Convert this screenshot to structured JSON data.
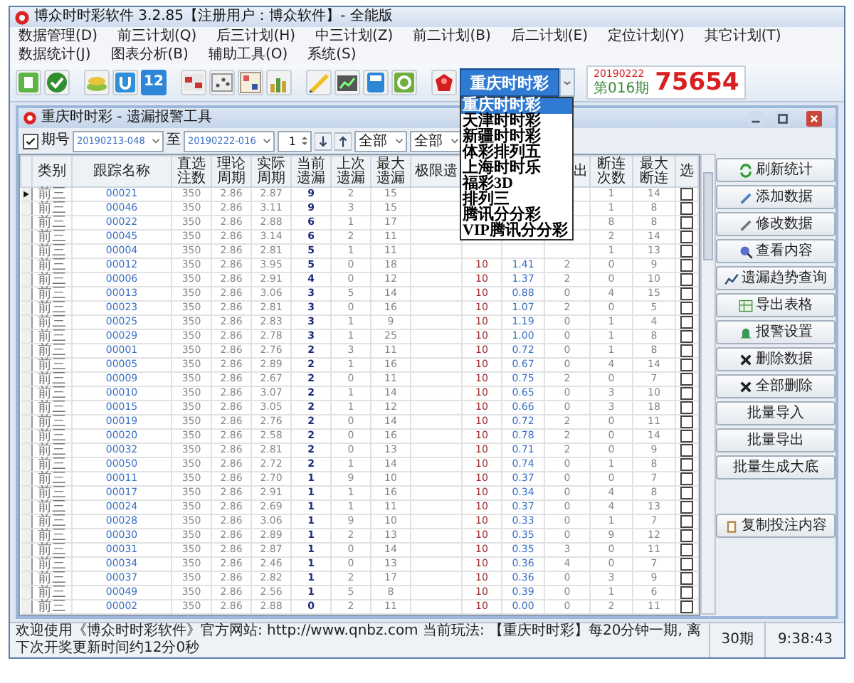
{
  "window": {
    "title": "博众时时彩软件 3.2.85【注册用户：博众软件】- 全能版"
  },
  "menu": [
    "数据管理(D)",
    "前三计划(Q)",
    "后三计划(H)",
    "中三计划(Z)",
    "前二计划(B)",
    "后二计划(E)",
    "定位计划(Y)",
    "其它计划(T)",
    "数据统计(J)",
    "图表分析(B)",
    "辅助工具(O)",
    "系统(S)"
  ],
  "toolbar": {
    "number_label": "12",
    "lottery_select": {
      "value": "重庆时时彩",
      "expanded": true,
      "options": [
        {
          "label": "重庆时时彩",
          "selected": true
        },
        {
          "label": "天津时时彩",
          "selected": false
        },
        {
          "label": "新疆时时彩",
          "selected": false
        },
        {
          "label": "体彩排列五",
          "selected": false
        },
        {
          "label": "上海时时乐",
          "selected": false
        },
        {
          "label": "福彩3D",
          "selected": false
        },
        {
          "label": "排列三",
          "selected": false
        },
        {
          "label": "腾讯分分彩",
          "selected": false
        },
        {
          "label": "VIP腾讯分分彩",
          "selected": false
        }
      ]
    },
    "latest_draw": {
      "date": "20190222",
      "issue": "第016期",
      "number": "75654"
    }
  },
  "child_window": {
    "title": "重庆时时彩 - 遗漏报警工具",
    "filter": {
      "issue_enabled": true,
      "issue_label": "期号",
      "from": "20190213-048",
      "to_label": "至",
      "to": "20190222-016",
      "step": "1",
      "filter_1": "全部",
      "filter_2": "全部"
    },
    "table": {
      "columns": [
        "类别",
        "跟踪名称",
        "直选注数",
        "理论周期",
        "实际周期",
        "当前遗漏",
        "上次遗漏",
        "最大遗漏",
        "极限遗",
        null,
        null,
        "出",
        "断连次数",
        "最大断连",
        "选"
      ],
      "rows": [
        {
          "selected": true,
          "checked": false,
          "cells": [
            "前三",
            "00021",
            "350",
            "2.86",
            "2.87",
            "9",
            "2",
            "15",
            null,
            null,
            null,
            null,
            "1",
            "14"
          ]
        },
        {
          "selected": false,
          "checked": false,
          "cells": [
            "前三",
            "00046",
            "350",
            "2.86",
            "3.11",
            "9",
            "3",
            "15",
            null,
            null,
            null,
            null,
            "1",
            "8"
          ]
        },
        {
          "selected": false,
          "checked": false,
          "cells": [
            "前三",
            "00022",
            "350",
            "2.86",
            "2.88",
            "6",
            "1",
            "17",
            null,
            null,
            null,
            null,
            "8",
            "8"
          ]
        },
        {
          "selected": false,
          "checked": false,
          "cells": [
            "前三",
            "00045",
            "350",
            "2.86",
            "3.14",
            "6",
            "2",
            "11",
            null,
            null,
            null,
            null,
            "2",
            "14"
          ]
        },
        {
          "selected": false,
          "checked": false,
          "cells": [
            "前三",
            "00004",
            "350",
            "2.86",
            "2.81",
            "5",
            "1",
            "11",
            null,
            null,
            null,
            null,
            "1",
            "13"
          ]
        },
        {
          "selected": false,
          "checked": false,
          "cells": [
            "前三",
            "00012",
            "350",
            "2.86",
            "3.95",
            "5",
            "0",
            "18",
            null,
            "10",
            "1.41",
            "2",
            "0",
            "9"
          ]
        },
        {
          "selected": false,
          "checked": false,
          "cells": [
            "前三",
            "00006",
            "350",
            "2.86",
            "2.91",
            "4",
            "0",
            "12",
            null,
            "10",
            "1.37",
            "2",
            "0",
            "10"
          ]
        },
        {
          "selected": false,
          "checked": false,
          "cells": [
            "前三",
            "00013",
            "350",
            "2.86",
            "3.06",
            "3",
            "5",
            "14",
            null,
            "10",
            "0.88",
            "0",
            "4",
            "15"
          ]
        },
        {
          "selected": false,
          "checked": false,
          "cells": [
            "前三",
            "00023",
            "350",
            "2.86",
            "2.81",
            "3",
            "0",
            "16",
            null,
            "10",
            "1.07",
            "2",
            "0",
            "5"
          ]
        },
        {
          "selected": false,
          "checked": false,
          "cells": [
            "前三",
            "00025",
            "350",
            "2.86",
            "2.83",
            "3",
            "1",
            "9",
            null,
            "10",
            "1.19",
            "0",
            "1",
            "4"
          ]
        },
        {
          "selected": false,
          "checked": false,
          "cells": [
            "前三",
            "00029",
            "350",
            "2.86",
            "2.78",
            "3",
            "1",
            "25",
            null,
            "10",
            "1.00",
            "0",
            "1",
            "8"
          ]
        },
        {
          "selected": false,
          "checked": false,
          "cells": [
            "前三",
            "00001",
            "350",
            "2.86",
            "2.76",
            "2",
            "3",
            "11",
            null,
            "10",
            "0.72",
            "0",
            "1",
            "8"
          ]
        },
        {
          "selected": false,
          "checked": false,
          "cells": [
            "前三",
            "00005",
            "350",
            "2.86",
            "2.89",
            "2",
            "1",
            "16",
            null,
            "10",
            "0.67",
            "0",
            "4",
            "14"
          ]
        },
        {
          "selected": false,
          "checked": false,
          "cells": [
            "前三",
            "00009",
            "350",
            "2.86",
            "2.67",
            "2",
            "0",
            "11",
            null,
            "10",
            "0.75",
            "2",
            "0",
            "7"
          ]
        },
        {
          "selected": false,
          "checked": false,
          "cells": [
            "前三",
            "00010",
            "350",
            "2.86",
            "3.07",
            "2",
            "1",
            "14",
            null,
            "10",
            "0.65",
            "0",
            "3",
            "10"
          ]
        },
        {
          "selected": false,
          "checked": false,
          "cells": [
            "前三",
            "00015",
            "350",
            "2.86",
            "3.05",
            "2",
            "1",
            "12",
            null,
            "10",
            "0.66",
            "0",
            "3",
            "18"
          ]
        },
        {
          "selected": false,
          "checked": false,
          "cells": [
            "前三",
            "00019",
            "350",
            "2.86",
            "2.76",
            "2",
            "0",
            "14",
            null,
            "10",
            "0.72",
            "2",
            "0",
            "11"
          ]
        },
        {
          "selected": false,
          "checked": false,
          "cells": [
            "前三",
            "00020",
            "350",
            "2.86",
            "2.58",
            "2",
            "0",
            "16",
            null,
            "10",
            "0.78",
            "2",
            "0",
            "14"
          ]
        },
        {
          "selected": false,
          "checked": false,
          "cells": [
            "前三",
            "00032",
            "350",
            "2.86",
            "2.81",
            "2",
            "0",
            "13",
            null,
            "10",
            "0.71",
            "2",
            "0",
            "9"
          ]
        },
        {
          "selected": false,
          "checked": false,
          "cells": [
            "前三",
            "00050",
            "350",
            "2.86",
            "2.72",
            "2",
            "1",
            "14",
            null,
            "10",
            "0.74",
            "0",
            "1",
            "8"
          ]
        },
        {
          "selected": false,
          "checked": false,
          "cells": [
            "前三",
            "00011",
            "350",
            "2.86",
            "2.70",
            "1",
            "9",
            "10",
            null,
            "10",
            "0.37",
            "0",
            "0",
            "7"
          ]
        },
        {
          "selected": false,
          "checked": false,
          "cells": [
            "前三",
            "00017",
            "350",
            "2.86",
            "2.91",
            "1",
            "1",
            "16",
            null,
            "10",
            "0.34",
            "0",
            "4",
            "8"
          ]
        },
        {
          "selected": false,
          "checked": false,
          "cells": [
            "前三",
            "00024",
            "350",
            "2.86",
            "2.69",
            "1",
            "1",
            "11",
            null,
            "10",
            "0.37",
            "0",
            "4",
            "13"
          ]
        },
        {
          "selected": false,
          "checked": false,
          "cells": [
            "前三",
            "00028",
            "350",
            "2.86",
            "3.06",
            "1",
            "9",
            "10",
            null,
            "10",
            "0.33",
            "0",
            "1",
            "7"
          ]
        },
        {
          "selected": false,
          "checked": false,
          "cells": [
            "前三",
            "00030",
            "350",
            "2.86",
            "2.89",
            "1",
            "2",
            "13",
            null,
            "10",
            "0.35",
            "0",
            "9",
            "12"
          ]
        },
        {
          "selected": false,
          "checked": false,
          "cells": [
            "前三",
            "00031",
            "350",
            "2.86",
            "2.87",
            "1",
            "0",
            "14",
            null,
            "10",
            "0.35",
            "3",
            "0",
            "11"
          ]
        },
        {
          "selected": false,
          "checked": false,
          "cells": [
            "前三",
            "00034",
            "350",
            "2.86",
            "2.46",
            "1",
            "0",
            "13",
            null,
            "10",
            "0.36",
            "4",
            "0",
            "7"
          ]
        },
        {
          "selected": false,
          "checked": false,
          "cells": [
            "前三",
            "00037",
            "350",
            "2.86",
            "2.82",
            "1",
            "2",
            "17",
            null,
            "10",
            "0.36",
            "0",
            "3",
            "9"
          ]
        },
        {
          "selected": false,
          "checked": false,
          "cells": [
            "前三",
            "00049",
            "350",
            "2.86",
            "2.56",
            "1",
            "5",
            "8",
            null,
            "10",
            "0.39",
            "0",
            "1",
            "6"
          ]
        },
        {
          "selected": false,
          "checked": false,
          "cells": [
            "前三",
            "00002",
            "350",
            "2.86",
            "2.88",
            "0",
            "2",
            "11",
            null,
            "10",
            "0.00",
            "0",
            "2",
            "11"
          ]
        }
      ]
    },
    "buttons": [
      {
        "label": "刷新统计",
        "kind": "refresh"
      },
      {
        "label": "添加数据",
        "kind": "add"
      },
      {
        "label": "修改数据",
        "kind": "edit"
      },
      {
        "label": "查看内容",
        "kind": "view"
      },
      {
        "label": "遗漏趋势查询",
        "kind": "trend"
      },
      {
        "label": "导出表格",
        "kind": "export"
      },
      {
        "label": "报警设置",
        "kind": "alarm"
      },
      {
        "label": "删除数据",
        "kind": "delete"
      },
      {
        "label": "全部删除",
        "kind": "delete"
      },
      {
        "label": "批量导入",
        "kind": "plain"
      },
      {
        "label": "批量导出",
        "kind": "plain"
      },
      {
        "label": "批量生成大底",
        "kind": "plain"
      },
      {
        "label": "复制投注内容",
        "kind": "copy"
      }
    ]
  },
  "status_bar": {
    "message": "欢迎使用《博众时时彩软件》官方网站: http://www.qnbz.com 当前玩法: 【重庆时时彩】每20分钟一期, 离下次开奖更新时间约12分0秒",
    "count": "30期",
    "time": "9:38:43"
  }
}
